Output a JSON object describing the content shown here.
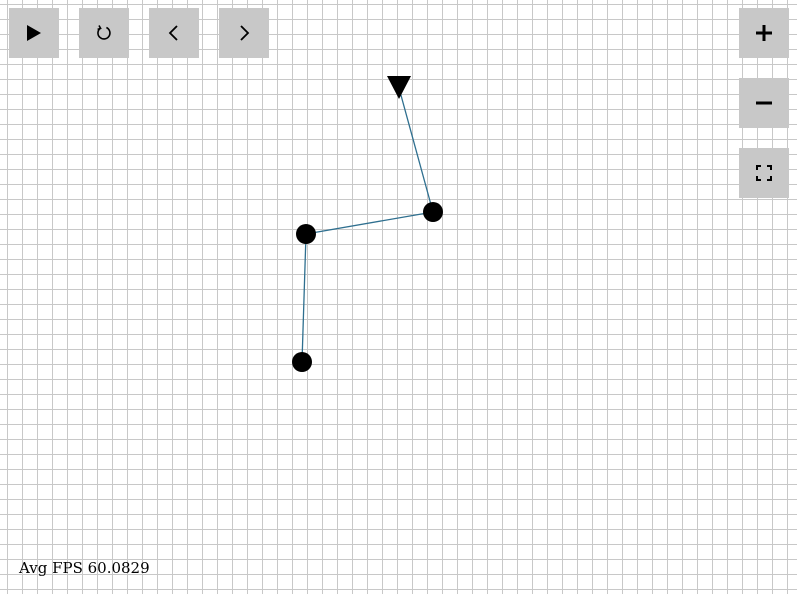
{
  "toolbar": {
    "buttons": [
      {
        "icon": "play-icon"
      },
      {
        "icon": "reset-icon"
      },
      {
        "icon": "chevron-left-icon"
      },
      {
        "icon": "chevron-right-icon"
      }
    ]
  },
  "zoom_controls": {
    "buttons": [
      {
        "icon": "plus-icon"
      },
      {
        "icon": "minus-icon"
      },
      {
        "icon": "fullscreen-icon"
      }
    ]
  },
  "status": {
    "fps_text": "Avg FPS 60.0829"
  },
  "colors": {
    "background": "#ffffff",
    "grid_line": "#c8c8c8",
    "button_bg": "#c8c8c8",
    "link": "#2e6f8f",
    "joint": "#000000"
  }
}
